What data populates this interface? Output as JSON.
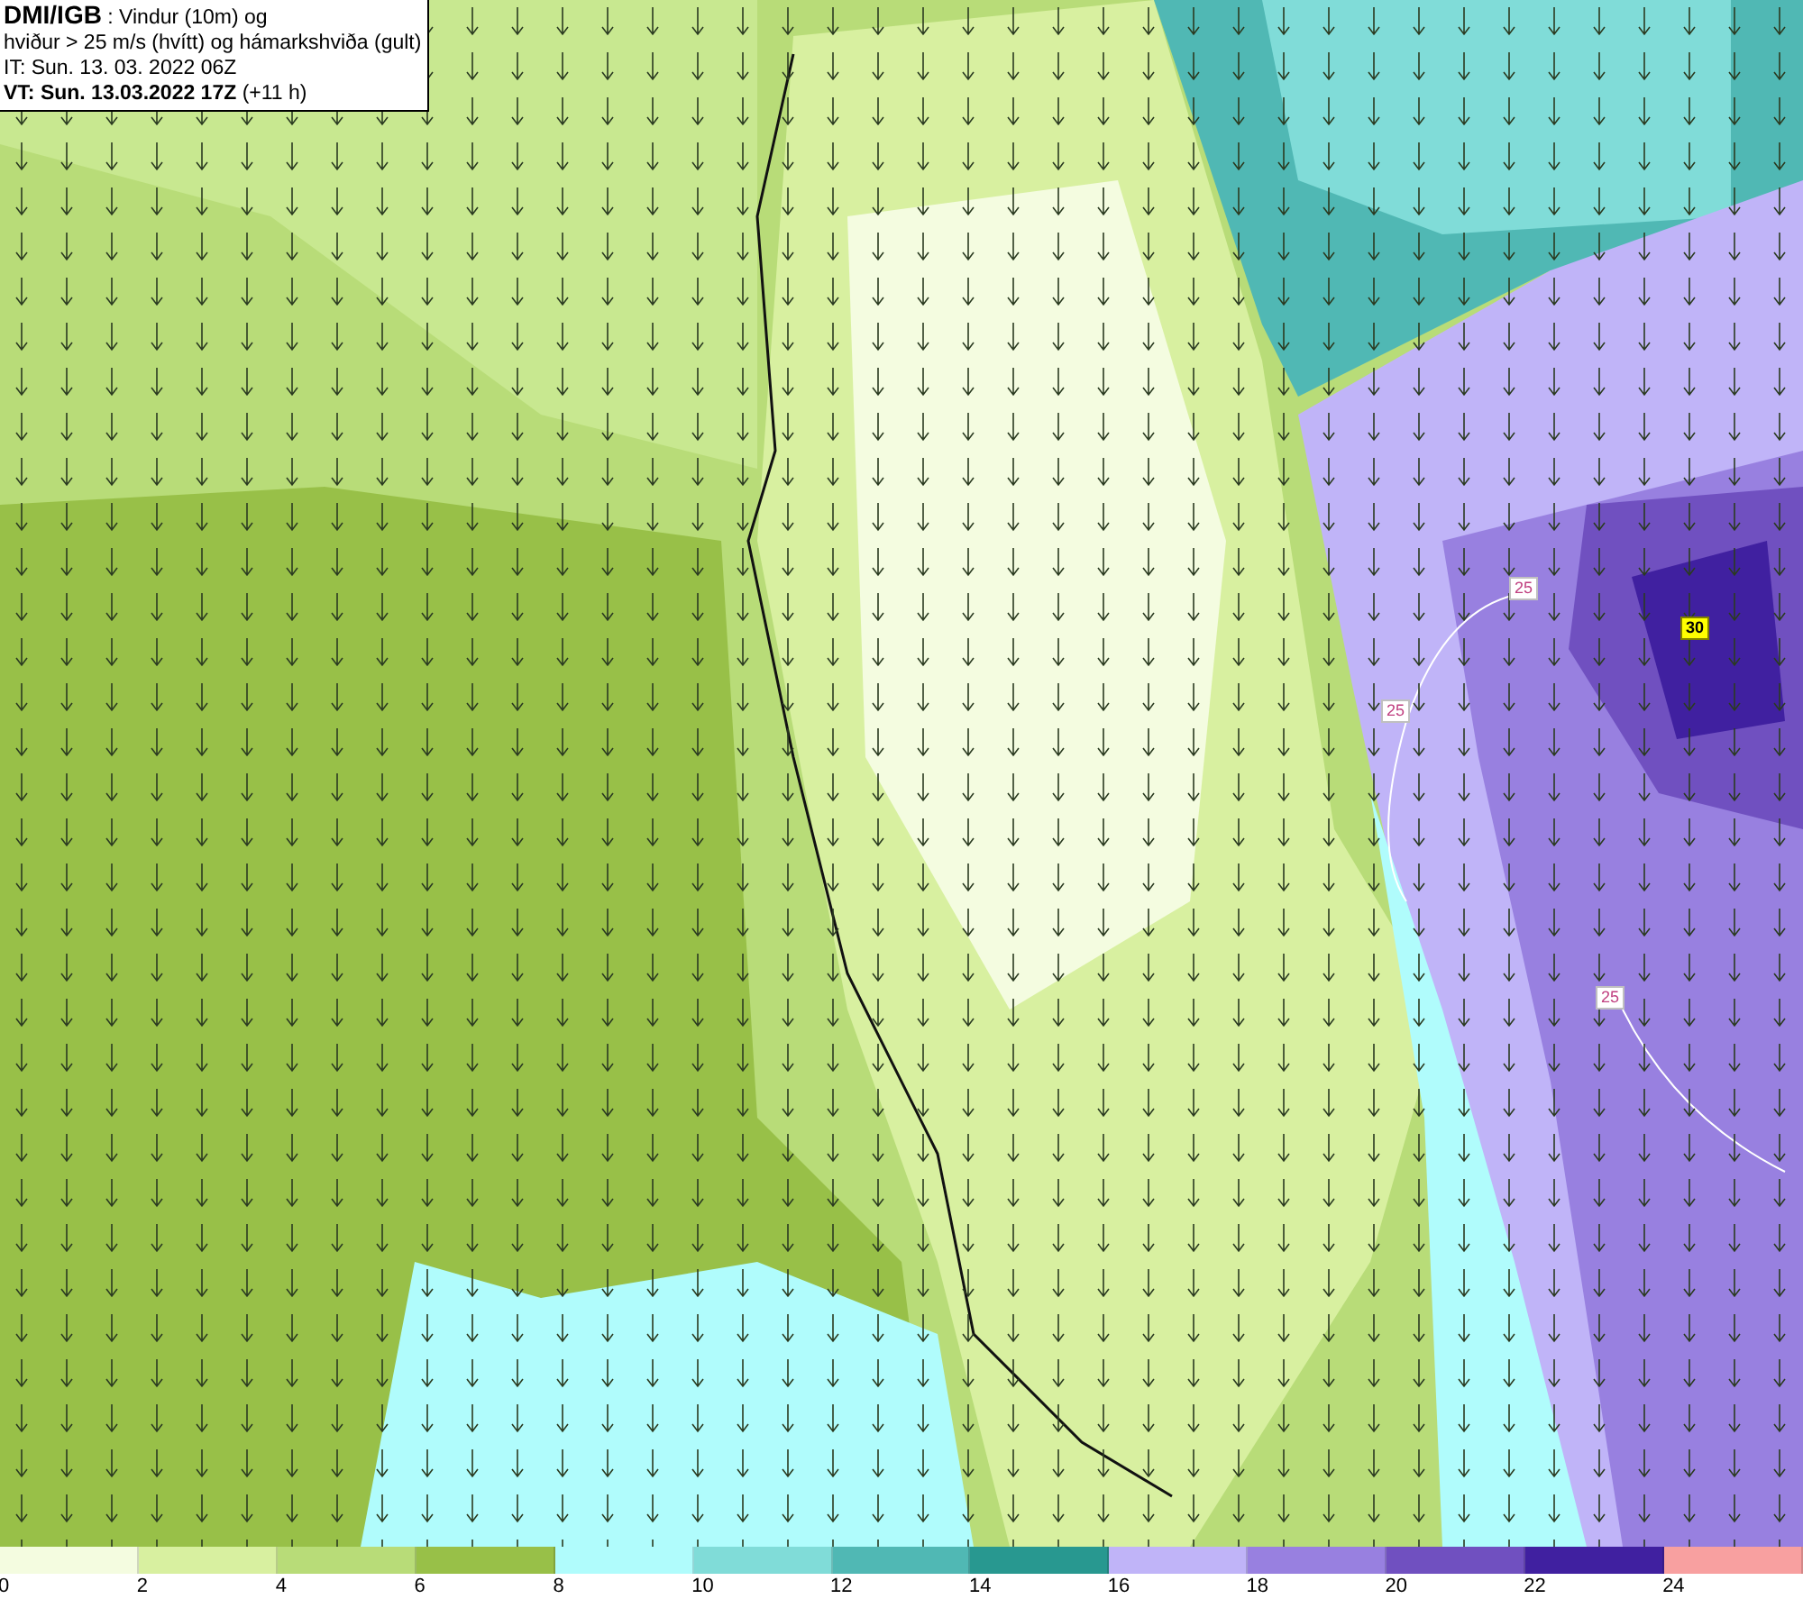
{
  "header": {
    "lines": [
      "**DMI/IGB** : Vindur (10m) og",
      "hviður > 25 m/s (hvítt) og hámarkshviða (gult)",
      "IT: Sun. 13. 03. 2022 06Z",
      "**VT: Sun. 13.03.2022 17Z** (+11 h)"
    ]
  },
  "map": {
    "contour_labels": [
      {
        "text": "25",
        "kind": "gust"
      },
      {
        "text": "25",
        "kind": "gust"
      },
      {
        "text": "25",
        "kind": "gust"
      },
      {
        "text": "30",
        "kind": "peak"
      }
    ]
  },
  "legend": {
    "swatches": [
      {
        "color": "#f4fce0"
      },
      {
        "color": "#d8f0a0"
      },
      {
        "color": "#b8dc78"
      },
      {
        "color": "#98c048"
      },
      {
        "color": "#b0fcfc"
      },
      {
        "color": "#80dcd8"
      },
      {
        "color": "#50b8b4"
      },
      {
        "color": "#289890"
      },
      {
        "color": "#c0b4f8"
      },
      {
        "color": "#9880e0"
      },
      {
        "color": "#7050c0"
      },
      {
        "color": "#4020a0"
      },
      {
        "color": "#f8a0a0"
      }
    ],
    "labels": [
      "0",
      "2",
      "4",
      "6",
      "8",
      "10",
      "12",
      "14",
      "16",
      "18",
      "20",
      "22",
      "24"
    ]
  }
}
